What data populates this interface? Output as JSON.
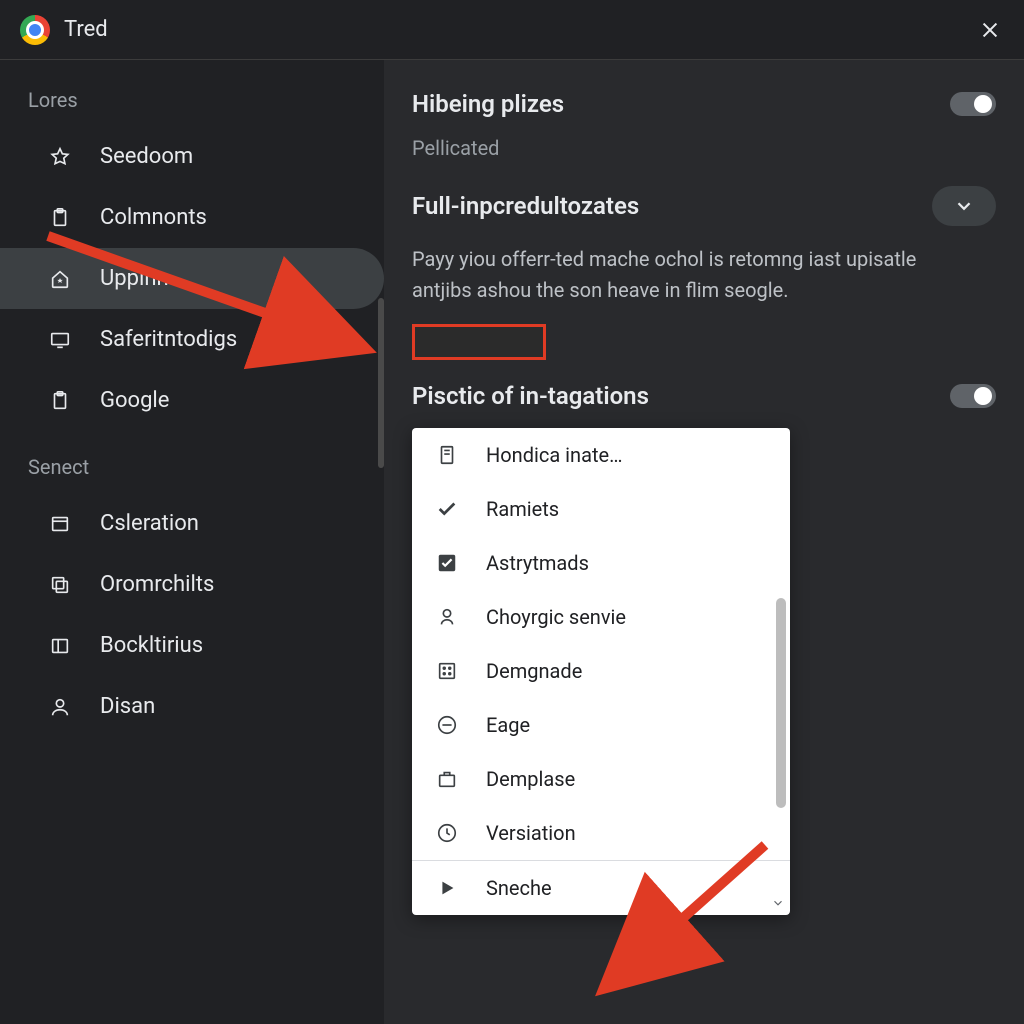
{
  "titlebar": {
    "title": "Tred"
  },
  "sidebar": {
    "group1_label": "Lores",
    "group2_label": "Senect",
    "items1": [
      {
        "label": "Seedoom"
      },
      {
        "label": "Colmnonts"
      },
      {
        "label": "Uppinn"
      },
      {
        "label": "Saferitntodigs"
      },
      {
        "label": "Google"
      }
    ],
    "items2": [
      {
        "label": "Csleration"
      },
      {
        "label": "Oromrchilts"
      },
      {
        "label": "Bockltirius"
      },
      {
        "label": "Disan"
      }
    ]
  },
  "content": {
    "setting1_title": "Hibeing plizes",
    "setting1_sub": "Pellicated",
    "setting2_title": "Full-inpcredultozates",
    "setting2_desc": "Payy yiou offerr-ted mache ochol is retomng iast upisatle antjibs ashou the son heave in flim seogle.",
    "setting3_title": "Pisctic of in-tagations"
  },
  "dropdown": {
    "items": [
      {
        "label": "Hondica inate…"
      },
      {
        "label": "Ramiets"
      },
      {
        "label": "Astrytmads"
      },
      {
        "label": "Choyrgic senvie"
      },
      {
        "label": "Demgnade"
      },
      {
        "label": "Eage"
      },
      {
        "label": "Demplase"
      },
      {
        "label": "Versiation"
      },
      {
        "label": "Sneche"
      }
    ]
  }
}
